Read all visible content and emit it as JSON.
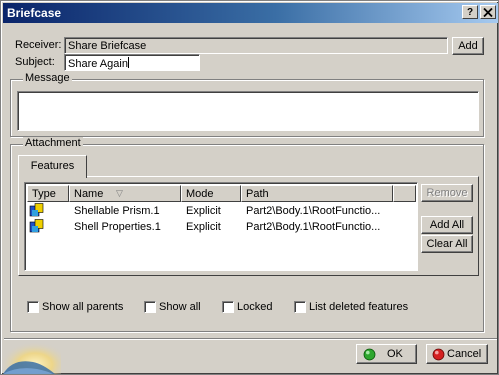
{
  "window": {
    "title": "Briefcase",
    "help_label": "?",
    "close_label": "X"
  },
  "receiver": {
    "label": "Receiver:",
    "value": "Share Briefcase",
    "add_label": "Add"
  },
  "subject": {
    "label": "Subject:",
    "value": "Share Again"
  },
  "message": {
    "label": "Message",
    "value": ""
  },
  "attachment": {
    "label": "Attachment",
    "tab_label": "Features",
    "columns": [
      "Type",
      "Name",
      "Mode",
      "Path"
    ],
    "sort_indicator": "▽",
    "rows": [
      {
        "type_icon": "feature-icon",
        "name": "Shellable Prism.1",
        "mode": "Explicit",
        "path": "Part2\\Body.1\\RootFunctio..."
      },
      {
        "type_icon": "feature-icon",
        "name": "Shell Properties.1",
        "mode": "Explicit",
        "path": "Part2\\Body.1\\RootFunctio..."
      }
    ],
    "buttons": {
      "remove": "Remove",
      "add_all": "Add All",
      "clear_all": "Clear All"
    }
  },
  "options": {
    "show_all_parents": "Show all parents",
    "show_all": "Show all",
    "locked": "Locked",
    "list_deleted": "List deleted features"
  },
  "footer": {
    "ok_label": "OK",
    "cancel_label": "Cancel",
    "ok_color": "#2ea62e",
    "cancel_color": "#d42020"
  }
}
